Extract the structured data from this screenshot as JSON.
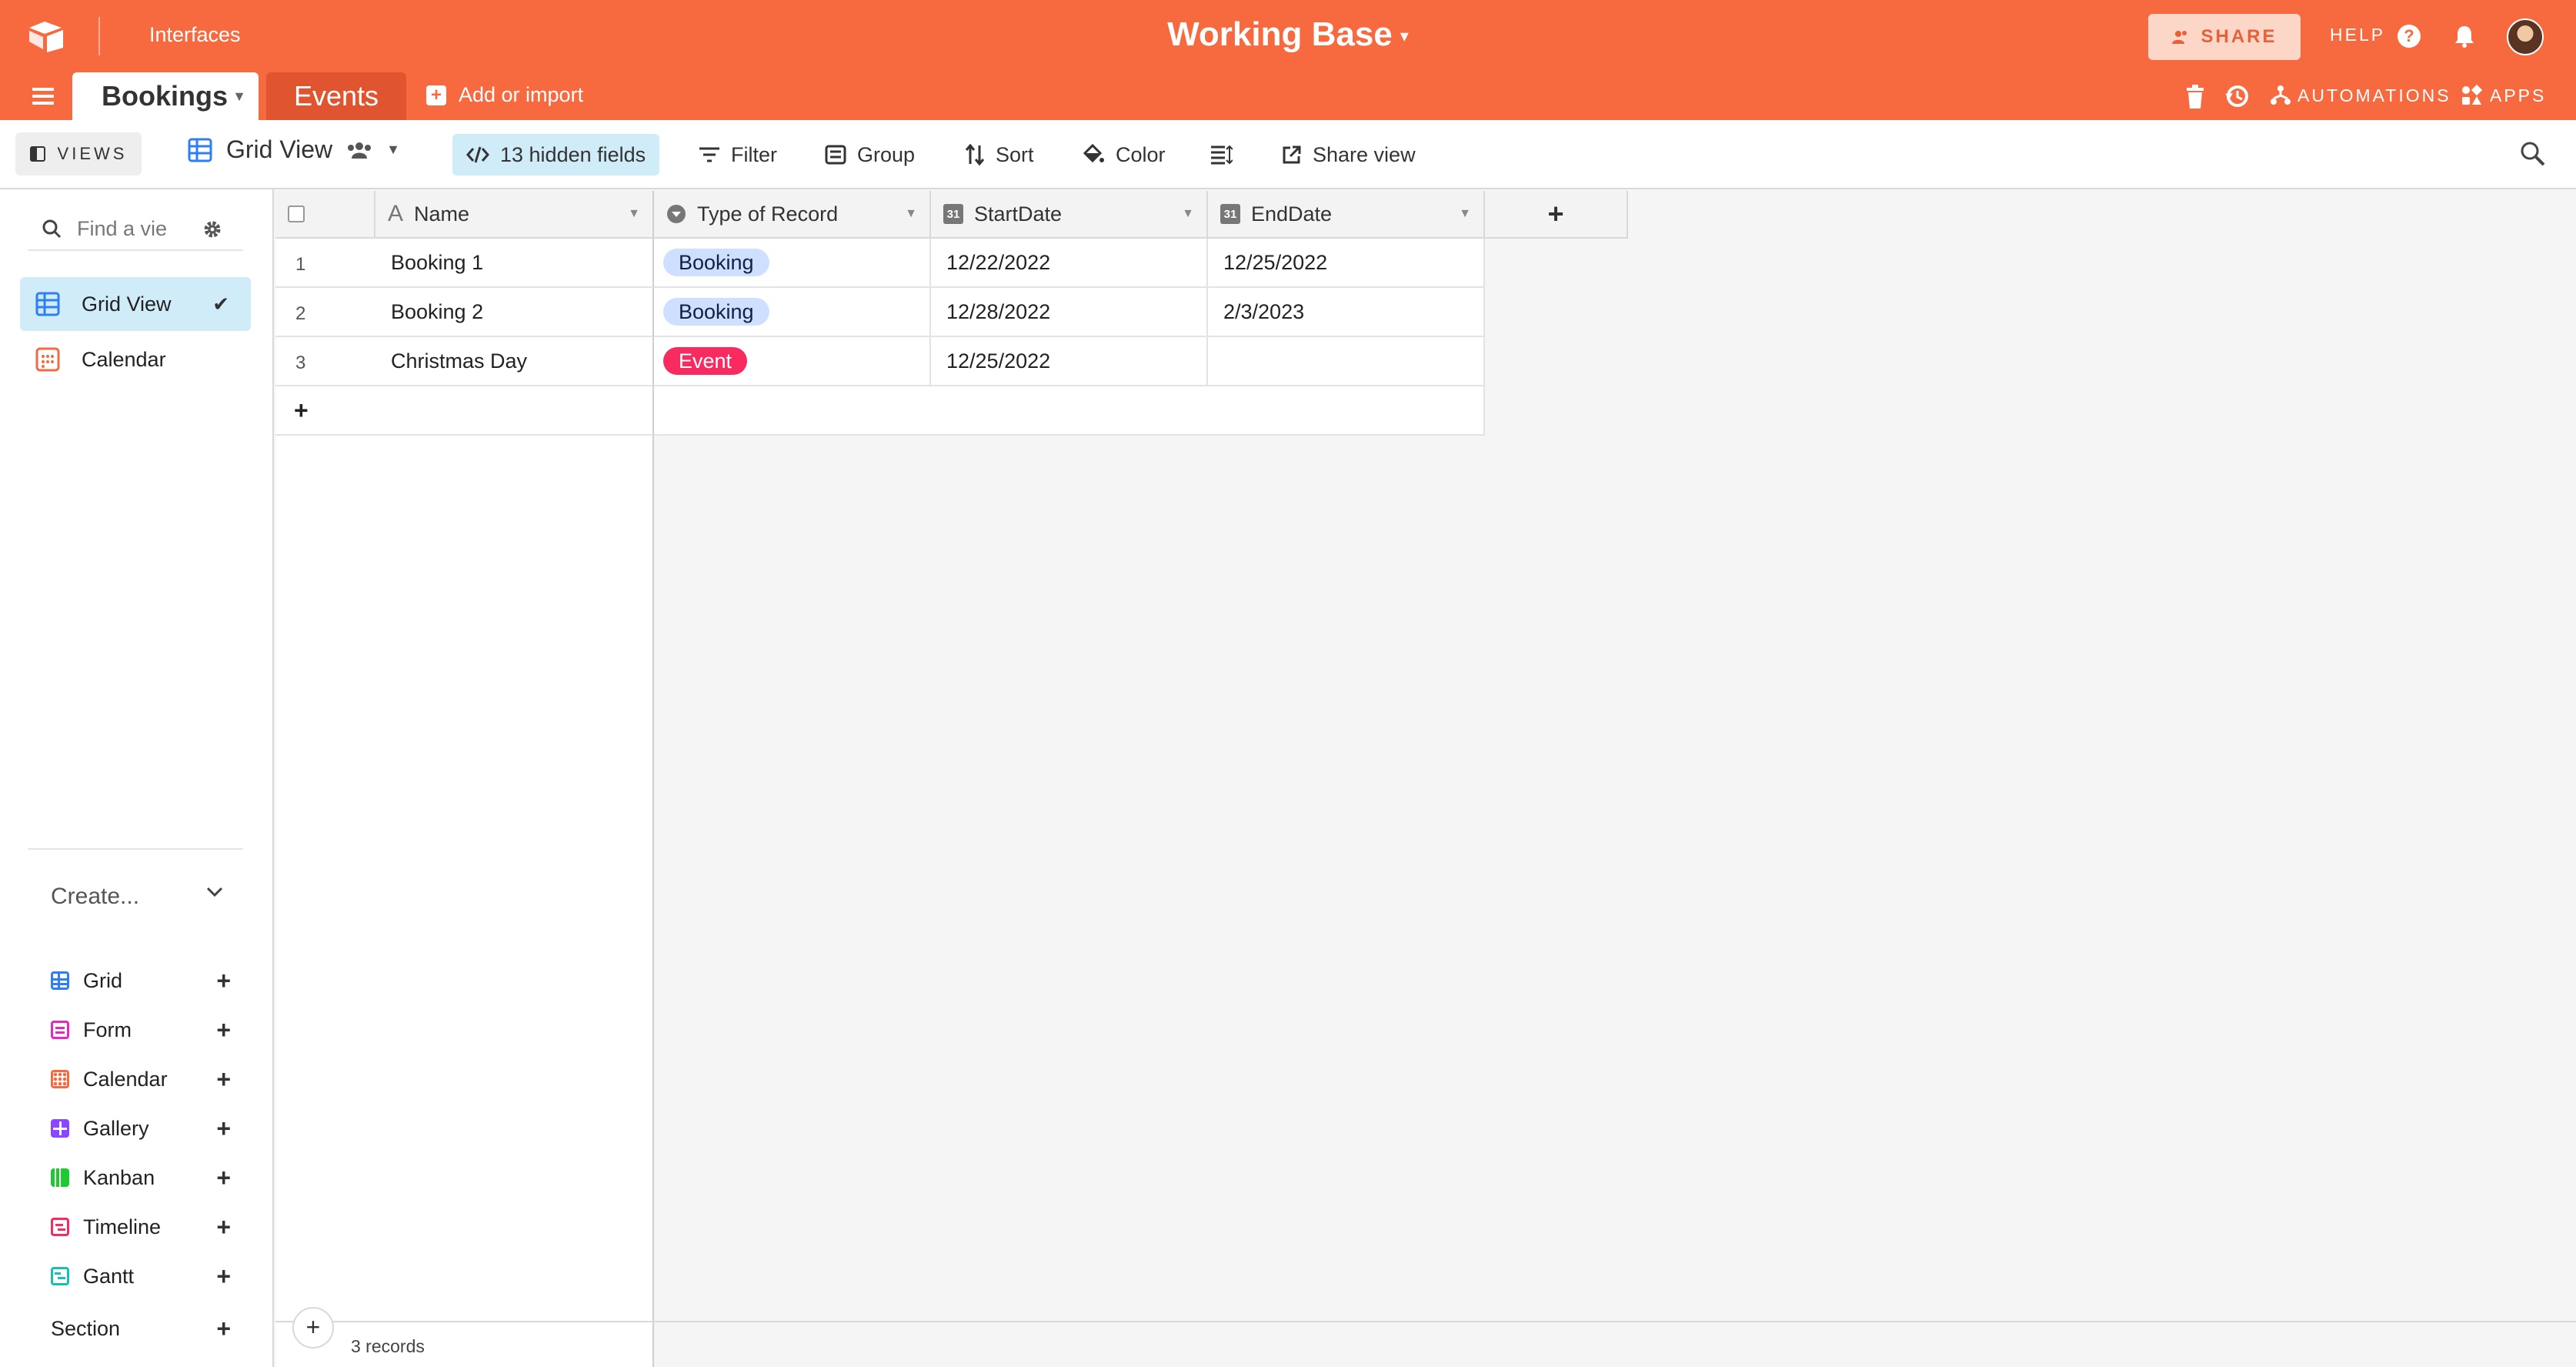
{
  "app": {
    "interfaces_label": "Interfaces",
    "base_title": "Working Base",
    "share_label": "SHARE",
    "help_label": "HELP",
    "help_icon_glyph": "?",
    "accent_color": "#f7693f"
  },
  "tables": {
    "active": "Bookings",
    "inactive": "Events",
    "add_import": "Add or import",
    "add_glyph": "+"
  },
  "toolbar_right": {
    "automations": "AUTOMATIONS",
    "apps": "APPS"
  },
  "viewbar": {
    "views_label": "VIEWS",
    "current_view": "Grid View",
    "hidden_fields": "13 hidden fields",
    "filter": "Filter",
    "group": "Group",
    "sort": "Sort",
    "color": "Color",
    "share_view": "Share view"
  },
  "sidebar": {
    "search_placeholder": "Find a vie",
    "views": [
      {
        "label": "Grid View",
        "icon": "grid-icon",
        "active": true
      },
      {
        "label": "Calendar",
        "icon": "calendar-icon",
        "active": false
      }
    ],
    "create_label": "Create...",
    "create_items": [
      {
        "label": "Grid",
        "color": "#2d7ff9"
      },
      {
        "label": "Form",
        "color": "#e929ba"
      },
      {
        "label": "Calendar",
        "color": "#f7693f"
      },
      {
        "label": "Gallery",
        "color": "#8b46ff"
      },
      {
        "label": "Kanban",
        "color": "#20c933"
      },
      {
        "label": "Timeline",
        "color": "#f82b60"
      },
      {
        "label": "Gantt",
        "color": "#18bfb4"
      }
    ],
    "section_label": "Section",
    "plus_glyph": "+"
  },
  "grid": {
    "columns": [
      {
        "label": "Name",
        "icon": "text-field-icon"
      },
      {
        "label": "Type of Record",
        "icon": "single-select-icon"
      },
      {
        "label": "StartDate",
        "icon": "date-field-icon"
      },
      {
        "label": "EndDate",
        "icon": "date-field-icon"
      }
    ],
    "date_icon_text": "31",
    "add_column_glyph": "+",
    "add_row_glyph": "+",
    "rows": [
      {
        "num": "1",
        "name": "Booking 1",
        "type": "Booking",
        "start": "12/22/2022",
        "end": "12/25/2022"
      },
      {
        "num": "2",
        "name": "Booking 2",
        "type": "Booking",
        "start": "12/28/2022",
        "end": "2/3/2023"
      },
      {
        "num": "3",
        "name": "Christmas Day",
        "type": "Event",
        "start": "12/25/2022",
        "end": ""
      }
    ],
    "type_colors": {
      "Booking": "#cfdfff",
      "Event": "#f82b60"
    },
    "records_label": "3 records"
  }
}
